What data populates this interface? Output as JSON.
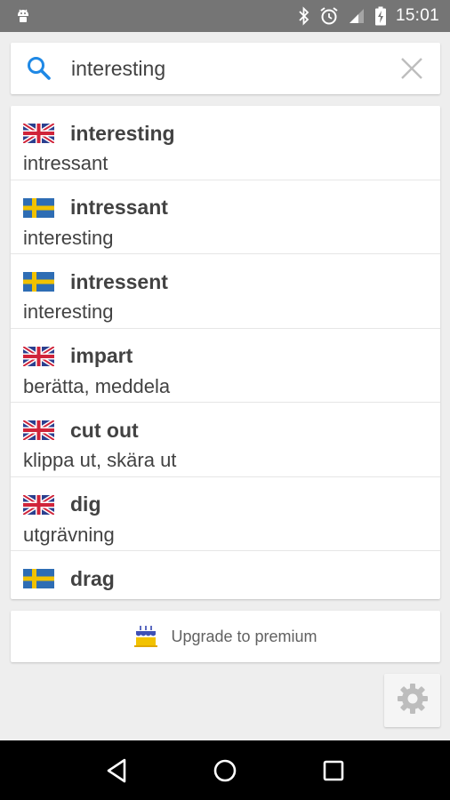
{
  "status_bar": {
    "time": "15:01",
    "icons": [
      "android-debug-icon",
      "bluetooth-icon",
      "alarm-icon",
      "signal-icon",
      "battery-charging-icon"
    ]
  },
  "search": {
    "value": "interesting",
    "placeholder": ""
  },
  "results": [
    {
      "flag": "uk",
      "term": "interesting",
      "translation": "intressant"
    },
    {
      "flag": "se",
      "term": "intressant",
      "translation": "interesting"
    },
    {
      "flag": "se",
      "term": "intressent",
      "translation": "interesting"
    },
    {
      "flag": "uk",
      "term": "impart",
      "translation": "berätta, meddela"
    },
    {
      "flag": "uk",
      "term": "cut out",
      "translation": "klippa ut, skära ut"
    },
    {
      "flag": "uk",
      "term": "dig",
      "translation": "utgrävning"
    },
    {
      "flag": "se",
      "term": "drag",
      "translation": ""
    }
  ],
  "upgrade": {
    "label": "Upgrade to premium",
    "icon": "cake-icon"
  },
  "settings": {
    "icon": "gear-icon"
  },
  "nav": {
    "icons": [
      "back-icon",
      "home-icon",
      "recents-icon"
    ]
  },
  "colors": {
    "status_bar": "#757575",
    "background": "#eeeeee",
    "search_accent": "#1e88e5",
    "sweden_blue": "#2e6db4",
    "sweden_yellow": "#f2c200",
    "uk_blue": "#2b3f8f",
    "uk_red": "#d0243a"
  }
}
